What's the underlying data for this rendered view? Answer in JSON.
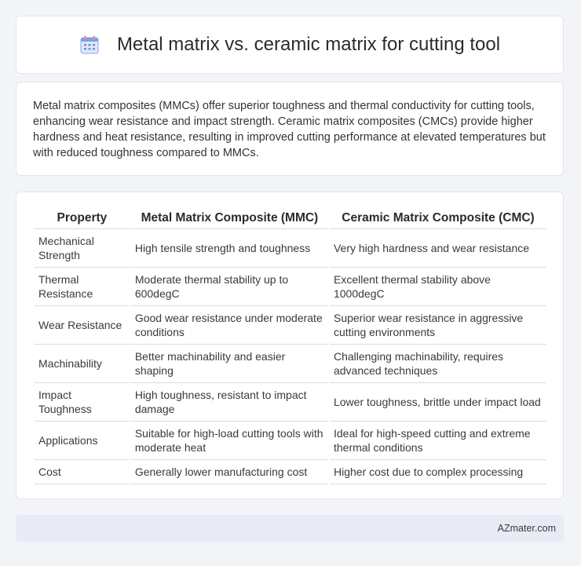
{
  "header": {
    "title": "Metal matrix vs. ceramic matrix for cutting tool",
    "icon": "calendar-icon",
    "icon_color": "#4f7fd6",
    "icon_accent": "#f08a8a"
  },
  "summary": {
    "text": "Metal matrix composites (MMCs) offer superior toughness and thermal conductivity for cutting tools, enhancing wear resistance and impact strength. Ceramic matrix composites (CMCs) provide higher hardness and heat resistance, resulting in improved cutting performance at elevated temperatures but with reduced toughness compared to MMCs."
  },
  "table": {
    "headers": [
      "Property",
      "Metal Matrix Composite (MMC)",
      "Ceramic Matrix Composite (CMC)"
    ],
    "rows": [
      [
        "Mechanical Strength",
        "High tensile strength and toughness",
        "Very high hardness and wear resistance"
      ],
      [
        "Thermal Resistance",
        "Moderate thermal stability up to 600degC",
        "Excellent thermal stability above 1000degC"
      ],
      [
        "Wear Resistance",
        "Good wear resistance under moderate conditions",
        "Superior wear resistance in aggressive cutting environments"
      ],
      [
        "Machinability",
        "Better machinability and easier shaping",
        "Challenging machinability, requires advanced techniques"
      ],
      [
        "Impact Toughness",
        "High toughness, resistant to impact damage",
        "Lower toughness, brittle under impact load"
      ],
      [
        "Applications",
        "Suitable for high-load cutting tools with moderate heat",
        "Ideal for high-speed cutting and extreme thermal conditions"
      ],
      [
        "Cost",
        "Generally lower manufacturing cost",
        "Higher cost due to complex processing"
      ]
    ]
  },
  "footer": {
    "brand": "AZmater.com"
  }
}
